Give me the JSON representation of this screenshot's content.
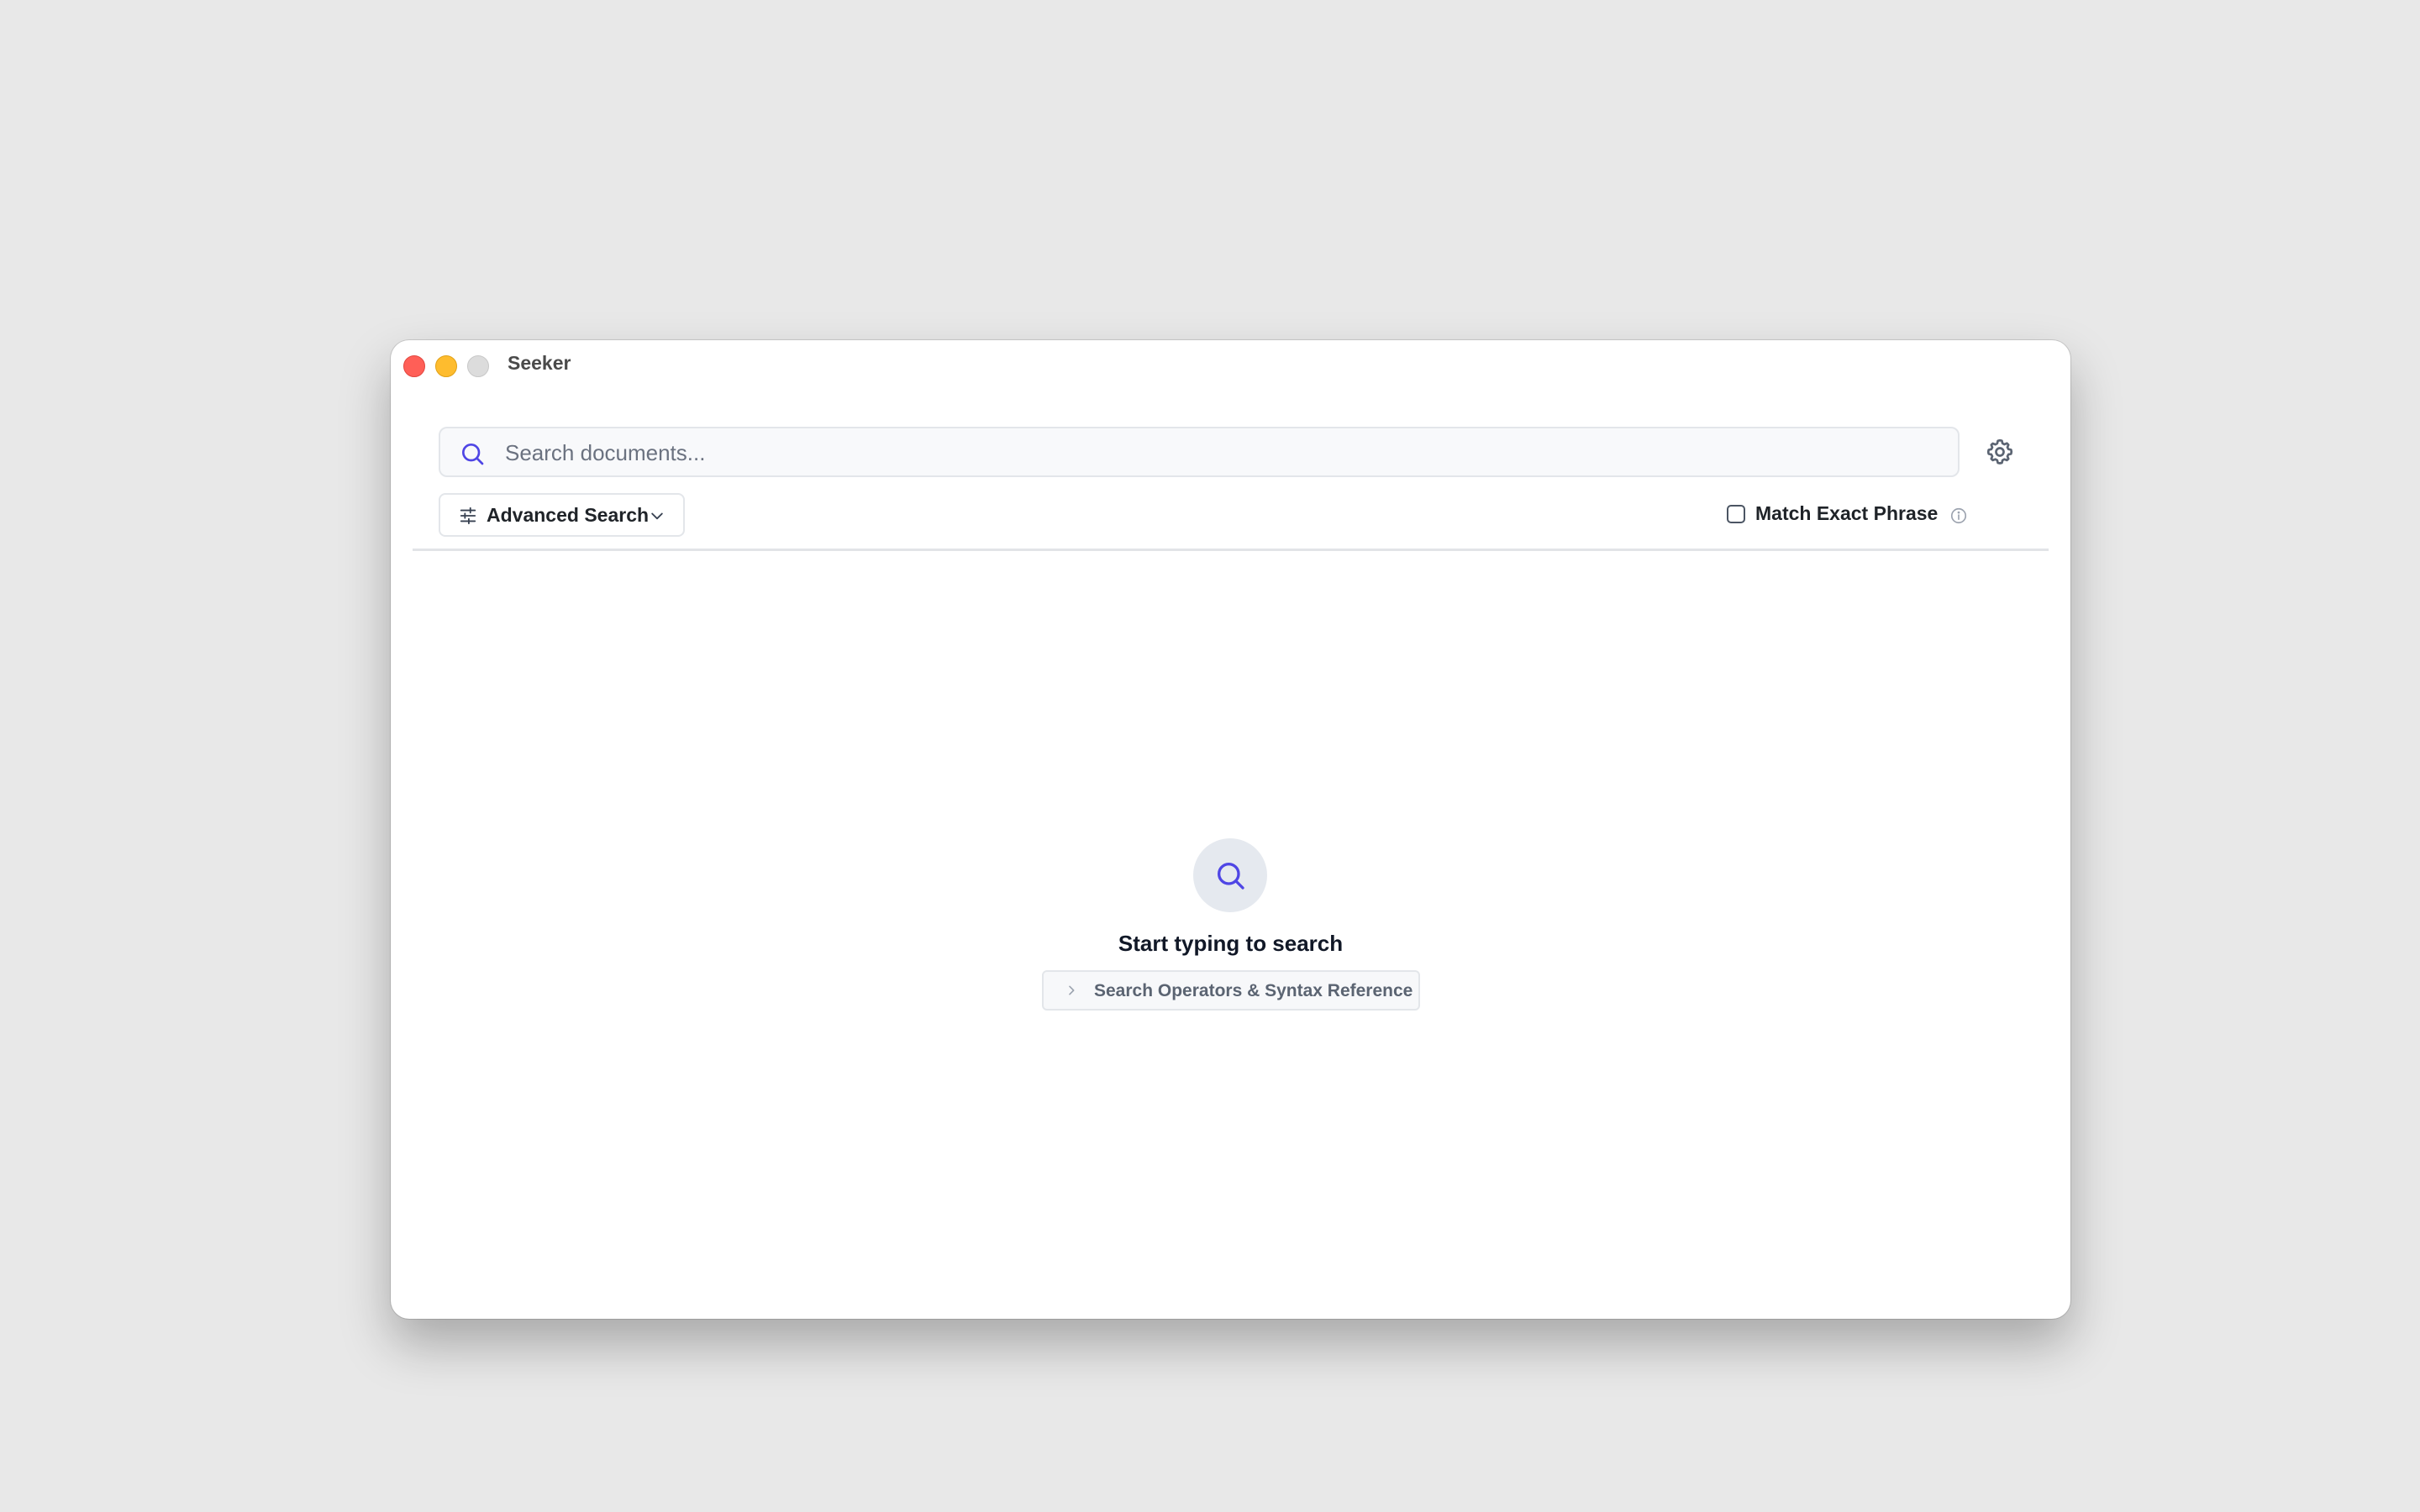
{
  "window": {
    "title": "Seeker"
  },
  "search": {
    "placeholder": "Search documents...",
    "value": ""
  },
  "toolbar": {
    "advanced_search_label": "Advanced Search",
    "match_exact_phrase_label": "Match Exact Phrase",
    "match_exact_phrase_checked": false
  },
  "empty_state": {
    "title": "Start typing to search",
    "syntax_reference_label": "Search Operators & Syntax Reference"
  },
  "icons": {
    "search": "search-icon",
    "settings": "gear-icon",
    "advanced": "sliders-icon",
    "dropdown": "chevron-down-icon",
    "info": "info-icon",
    "expand": "chevron-right-icon"
  },
  "colors": {
    "accent": "#4f46e5",
    "traffic_close": "#ff5f57",
    "traffic_minimize": "#febc2e",
    "traffic_maximize": "#dcdcdc"
  }
}
